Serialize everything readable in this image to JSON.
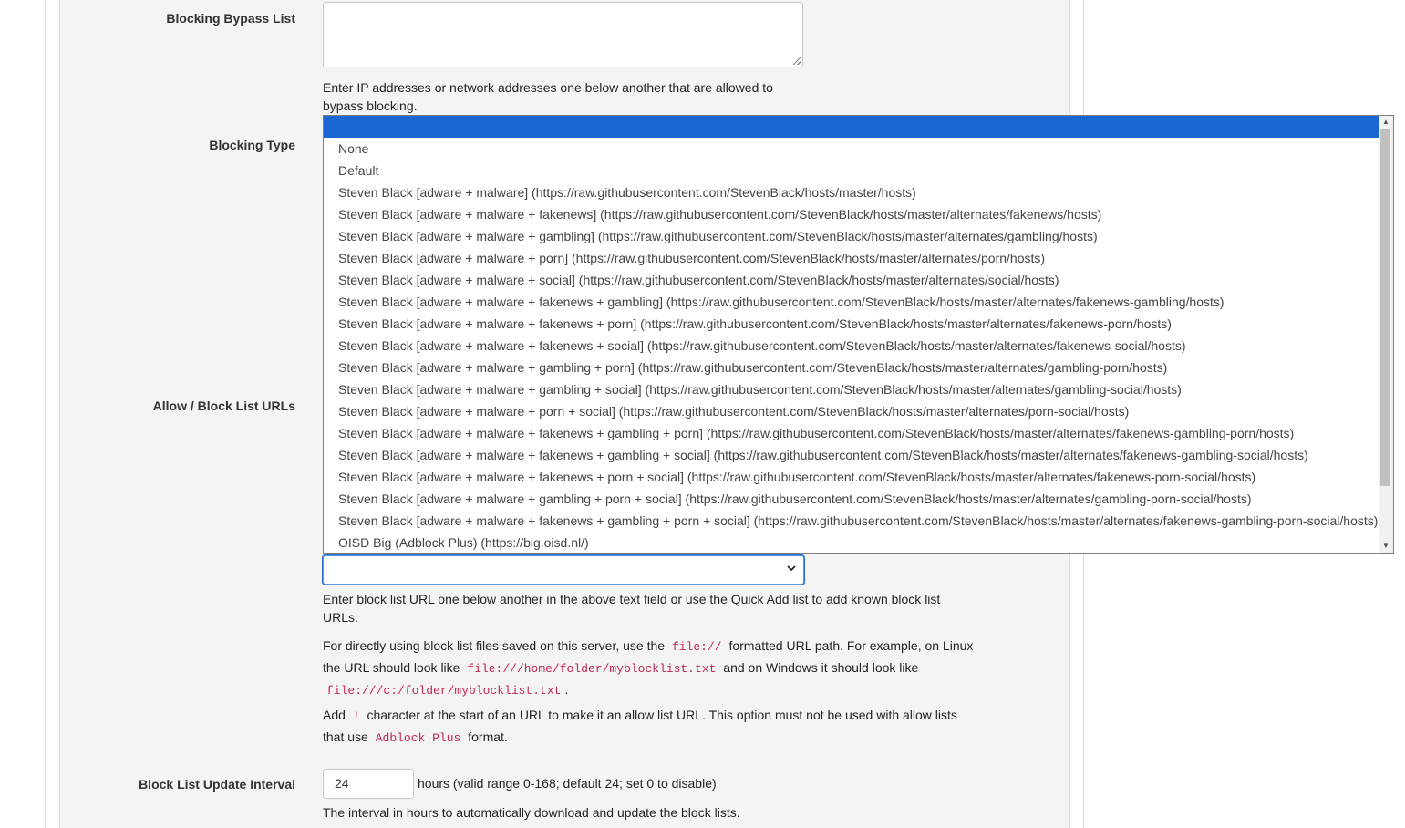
{
  "form": {
    "bypass": {
      "label": "Blocking Bypass List",
      "value": "",
      "help_line1": "Enter IP addresses or network addresses one below another that are allowed to",
      "help_line2": "bypass blocking."
    },
    "blocking_type": {
      "label": "Blocking Type"
    },
    "allow_block": {
      "label": "Allow / Block List URLs",
      "quick_add_value": "",
      "help1_line1": "Enter block list URL one below another in the above text field or use the Quick Add list to add known block list",
      "help1_line2": "URLs.",
      "help2_a": "For directly using block list files saved on this server, use the",
      "help2_code1": "file://",
      "help2_b": "formatted URL path. For example, on Linux",
      "help2_c": "the URL should look like",
      "help2_code2": "file:///home/folder/myblocklist.txt",
      "help2_d": "and on Windows it should look like",
      "help2_code3": "file:///c:/folder/myblocklist.txt",
      "help2_e": ".",
      "help3_a": "Add",
      "help3_code1": "!",
      "help3_b": "character at the start of an URL to make it an allow list URL. This option must not be used with allow lists",
      "help3_c": "that use",
      "help3_code2": "Adblock Plus",
      "help3_d": "format."
    },
    "update_interval": {
      "label": "Block List Update Interval",
      "value": "24",
      "suffix": "hours (valid range 0-168; default 24; set 0 to disable)",
      "help": "The interval in hours to automatically download and update the block lists."
    }
  },
  "dropdown": {
    "highlighted": "",
    "options": [
      "None",
      "Default",
      "Steven Black [adware + malware] (https://raw.githubusercontent.com/StevenBlack/hosts/master/hosts)",
      "Steven Black [adware + malware + fakenews] (https://raw.githubusercontent.com/StevenBlack/hosts/master/alternates/fakenews/hosts)",
      "Steven Black [adware + malware + gambling] (https://raw.githubusercontent.com/StevenBlack/hosts/master/alternates/gambling/hosts)",
      "Steven Black [adware + malware + porn] (https://raw.githubusercontent.com/StevenBlack/hosts/master/alternates/porn/hosts)",
      "Steven Black [adware + malware + social] (https://raw.githubusercontent.com/StevenBlack/hosts/master/alternates/social/hosts)",
      "Steven Black [adware + malware + fakenews + gambling] (https://raw.githubusercontent.com/StevenBlack/hosts/master/alternates/fakenews-gambling/hosts)",
      "Steven Black [adware + malware + fakenews + porn] (https://raw.githubusercontent.com/StevenBlack/hosts/master/alternates/fakenews-porn/hosts)",
      "Steven Black [adware + malware + fakenews + social] (https://raw.githubusercontent.com/StevenBlack/hosts/master/alternates/fakenews-social/hosts)",
      "Steven Black [adware + malware + gambling + porn] (https://raw.githubusercontent.com/StevenBlack/hosts/master/alternates/gambling-porn/hosts)",
      "Steven Black [adware + malware + gambling + social] (https://raw.githubusercontent.com/StevenBlack/hosts/master/alternates/gambling-social/hosts)",
      "Steven Black [adware + malware + porn + social] (https://raw.githubusercontent.com/StevenBlack/hosts/master/alternates/porn-social/hosts)",
      "Steven Black [adware + malware + fakenews + gambling + porn] (https://raw.githubusercontent.com/StevenBlack/hosts/master/alternates/fakenews-gambling-porn/hosts)",
      "Steven Black [adware + malware + fakenews + gambling + social] (https://raw.githubusercontent.com/StevenBlack/hosts/master/alternates/fakenews-gambling-social/hosts)",
      "Steven Black [adware + malware + fakenews + porn + social] (https://raw.githubusercontent.com/StevenBlack/hosts/master/alternates/fakenews-porn-social/hosts)",
      "Steven Black [adware + malware + gambling + porn + social] (https://raw.githubusercontent.com/StevenBlack/hosts/master/alternates/gambling-porn-social/hosts)",
      "Steven Black [adware + malware + fakenews + gambling + porn + social] (https://raw.githubusercontent.com/StevenBlack/hosts/master/alternates/fakenews-gambling-porn-social/hosts)",
      "OISD Big (Adblock Plus) (https://big.oisd.nl/)"
    ]
  },
  "icons": {
    "select_chevron": "chevron-down-icon",
    "scroll_up": "scroll-up-arrow-icon",
    "scroll_down": "scroll-down-arrow-icon"
  },
  "colors": {
    "highlight": "#1a66d3",
    "code": "#c7254e",
    "panel": "#f4f4f4"
  }
}
